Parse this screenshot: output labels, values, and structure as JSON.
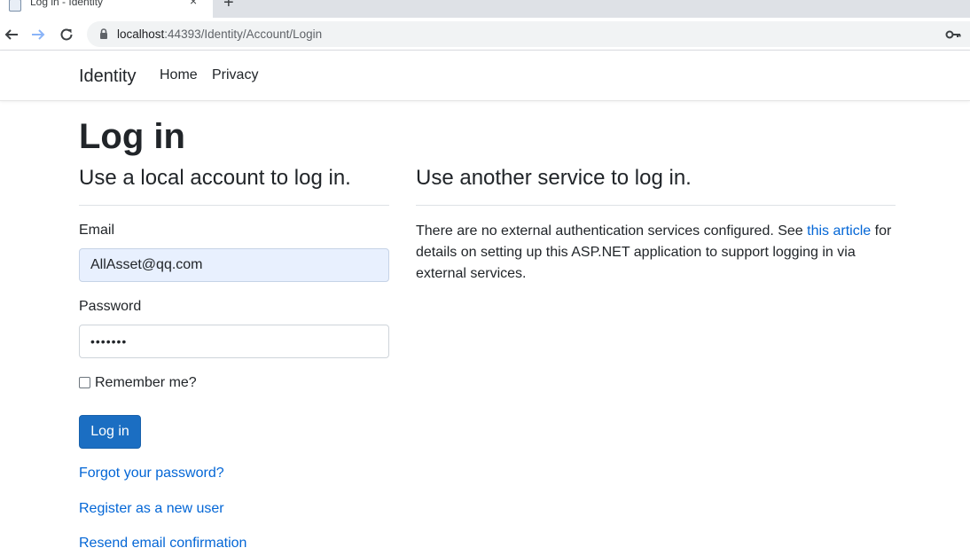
{
  "browser": {
    "tab_title": "Log in - Identity",
    "tab_close": "×",
    "new_tab": "+",
    "url_host": "localhost",
    "url_rest": ":44393/Identity/Account/Login"
  },
  "navbar": {
    "brand": "Identity",
    "links": [
      "Home",
      "Privacy"
    ]
  },
  "page": {
    "title": "Log in",
    "local_heading": "Use a local account to log in.",
    "external_heading": "Use another service to log in.",
    "email_label": "Email",
    "email_value": "AllAsset@qq.com",
    "password_label": "Password",
    "password_value": "•••••••",
    "remember_label": "Remember me?",
    "login_button": "Log in",
    "forgot_link": "Forgot your password?",
    "register_link": "Register as a new user",
    "resend_link": "Resend email confirmation",
    "external_text_before": "There are no external authentication services configured. See ",
    "external_link": "this article",
    "external_text_after": " for details on setting up this ASP.NET application to support logging in via external services."
  },
  "colors": {
    "primary_button": "#1b6ec2",
    "link": "#0366d6",
    "autofill_bg": "#e8f0fe"
  },
  "icons": [
    "favicon-icon",
    "close-icon",
    "plus-icon",
    "back-arrow-icon",
    "forward-arrow-icon",
    "reload-icon",
    "lock-icon",
    "key-icon"
  ]
}
